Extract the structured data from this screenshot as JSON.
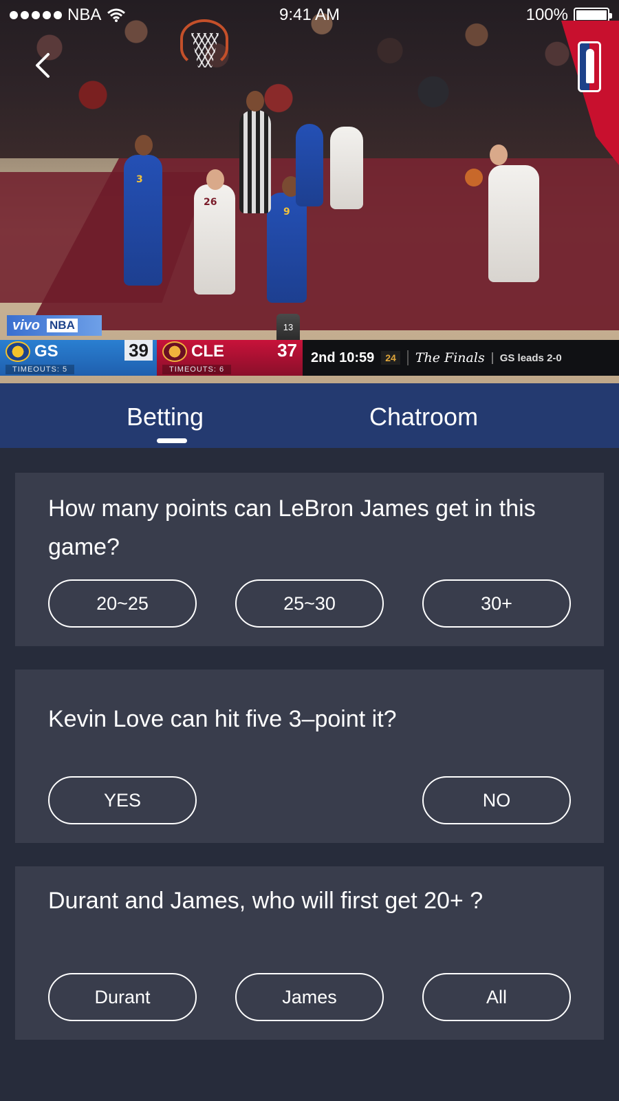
{
  "status_bar": {
    "carrier": "NBA",
    "time": "9:41 AM",
    "battery": "100%"
  },
  "video": {
    "overlay_text": "vivo",
    "overlay_brand": "NBA",
    "referee_number": "13",
    "scoreboard": {
      "away": {
        "abbr": "GS",
        "score": "39",
        "timeouts": "TIMEOUTS: 5"
      },
      "home": {
        "abbr": "CLE",
        "score": "37",
        "timeouts": "TIMEOUTS: 6"
      },
      "period_clock": "2nd 10:59",
      "shot_clock": "24",
      "event": "The Finals",
      "series": "GS leads 2-0"
    }
  },
  "tabs": {
    "items": [
      {
        "label": "Betting",
        "active": true
      },
      {
        "label": "Chatroom",
        "active": false
      }
    ]
  },
  "cards": [
    {
      "question": "How many points can LeBron James get in this game?",
      "options": [
        "20~25",
        "25~30",
        "30+"
      ]
    },
    {
      "question": "Kevin Love can hit five 3–point it?",
      "options": [
        "YES",
        "NO"
      ]
    },
    {
      "question": "Durant and James, who will first get 20+ ?",
      "options": [
        "Durant",
        "James",
        "All"
      ]
    }
  ],
  "colors": {
    "tab_bar": "#243a70",
    "page_bg": "#272c3b",
    "card_bg": "#393d4c",
    "nba_red": "#c8102e"
  }
}
